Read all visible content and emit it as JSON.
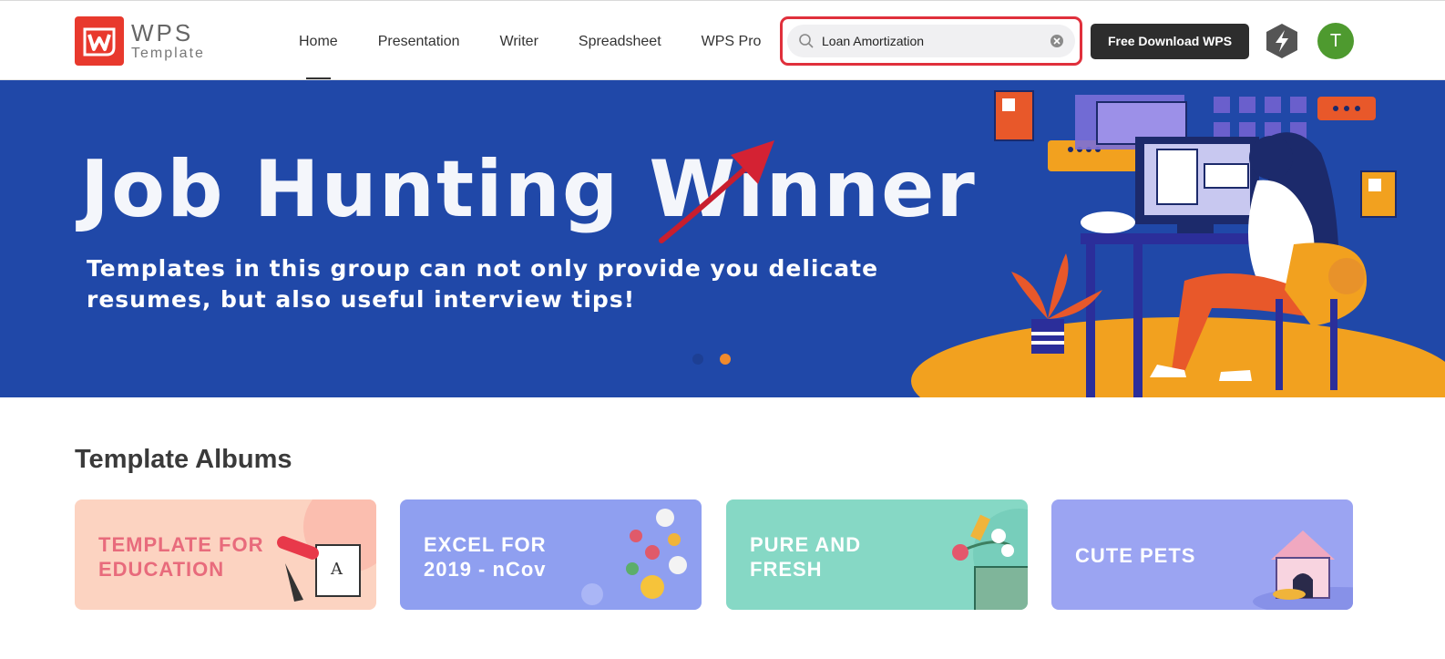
{
  "logo": {
    "brand": "WPS",
    "sub": "Template"
  },
  "nav": {
    "items": [
      "Home",
      "Presentation",
      "Writer",
      "Spreadsheet",
      "WPS Pro"
    ],
    "active": "Home"
  },
  "search": {
    "value": "Loan Amortization"
  },
  "header": {
    "download_label": "Free Download WPS",
    "avatar_letter": "T"
  },
  "banner": {
    "title": "Job Hunting Winner",
    "subtitle": "Templates in this group can not only provide you delicate resumes, but also useful interview tips!",
    "slide_count": 2,
    "active_slide": 2
  },
  "albums": {
    "heading": "Template Albums",
    "items": [
      {
        "label": "TEMPLATE FOR\nEDUCATION",
        "bg": "#fcd3c1",
        "fg": "#e86b7c"
      },
      {
        "label": "EXCEL FOR\n2019 - nCov",
        "bg": "#8f9ff0",
        "fg": "#ffffff"
      },
      {
        "label": "PURE AND\nFRESH",
        "bg": "#86d8c5",
        "fg": "#ffffff"
      },
      {
        "label": "CUTE PETS",
        "bg": "#9ba4f2",
        "fg": "#ffffff"
      }
    ]
  },
  "colors": {
    "accent": "#e8392d",
    "banner_bg": "#2048a8",
    "highlight": "#e0303c",
    "avatar": "#4e9a2f"
  },
  "icons": [
    "wps-logo-icon",
    "search-icon",
    "clear-icon",
    "bolt-icon",
    "red-arrow-annotation"
  ]
}
